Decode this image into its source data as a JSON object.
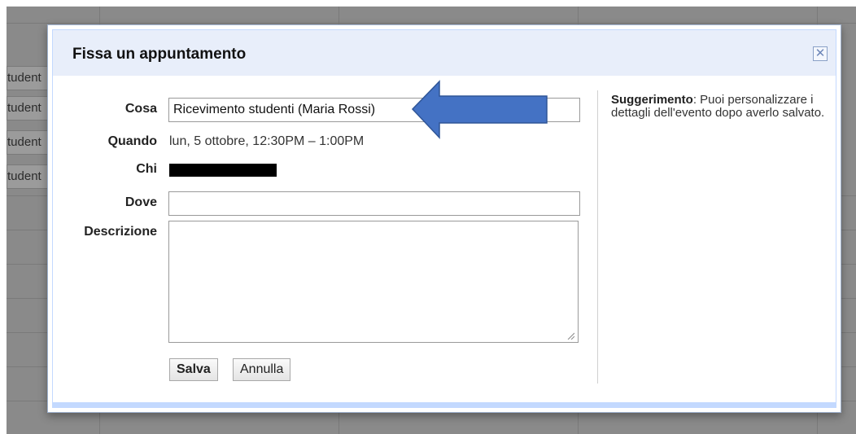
{
  "background": {
    "calendar_chips": [
      "tudent",
      "tudent",
      "tudent",
      "tudent"
    ]
  },
  "dialog": {
    "title": "Fissa un appuntamento",
    "close_icon": "close-icon",
    "fields": {
      "what": {
        "label": "Cosa",
        "value": "Ricevimento studenti (Maria Rossi)"
      },
      "when": {
        "label": "Quando",
        "value": "lun, 5 ottobre, 12:30PM – 1:00PM"
      },
      "who": {
        "label": "Chi",
        "value_redacted": true
      },
      "where": {
        "label": "Dove",
        "value": ""
      },
      "description": {
        "label": "Descrizione",
        "value": ""
      }
    },
    "buttons": {
      "save": "Salva",
      "cancel": "Annulla"
    },
    "tip": {
      "title": "Suggerimento",
      "text": ": Puoi personalizzare i dettagli dell'evento dopo averlo salvato."
    }
  },
  "annotation": {
    "arrow_color": "#4472c4",
    "arrow_border": "#2f5597"
  },
  "colors": {
    "header_bg": "#e8eefa",
    "dialog_frame": "#c3d9ff",
    "overlay_bg": "#8a8a8a"
  }
}
